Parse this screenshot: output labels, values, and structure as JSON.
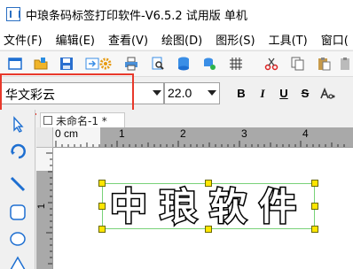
{
  "window": {
    "title": "中琅条码标签打印软件-V6.5.2 试用版 单机"
  },
  "menu": {
    "items": [
      "文件(F)",
      "编辑(E)",
      "查看(V)",
      "绘图(D)",
      "图形(S)",
      "工具(T)",
      "窗口("
    ]
  },
  "font_bar": {
    "font_name": "华文彩云",
    "font_size": "22.0",
    "bold": "B",
    "italic": "I",
    "underline": "U",
    "strikethrough": "S"
  },
  "document": {
    "tab_label": "未命名-1 *"
  },
  "ruler": {
    "unit_label": "0 cm",
    "top_marks": [
      "1",
      "2",
      "3",
      "4"
    ],
    "left_marks": [
      "1"
    ]
  },
  "canvas": {
    "text_object": "中琅软件"
  },
  "colors": {
    "highlight_border": "#e8392b",
    "handle_fill": "#ffe600",
    "selection_border": "#79d279"
  }
}
